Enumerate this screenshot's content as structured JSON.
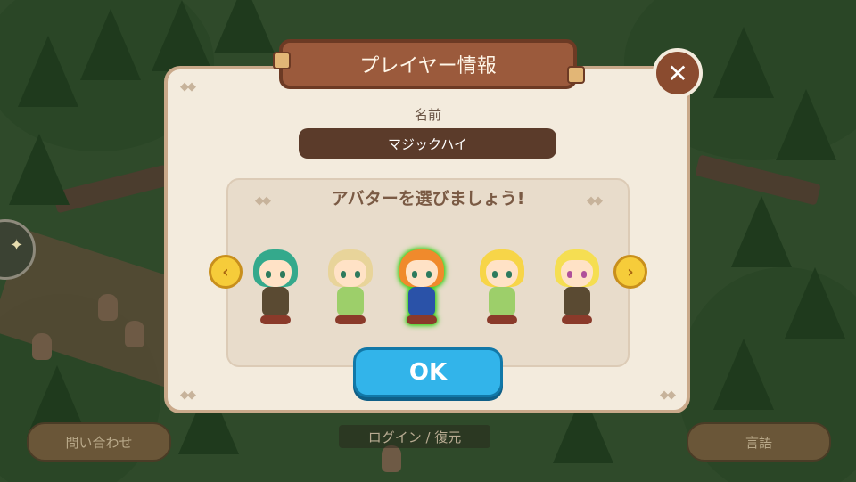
{
  "dialog": {
    "title": "プレイヤー情報",
    "name_label": "名前",
    "name_value": "マジックハイ",
    "avatar_heading": "アバターを選びましょう!",
    "ok_label": "OK",
    "close_icon": "close-icon",
    "prev_icon": "chevron-left-icon",
    "next_icon": "chevron-right-icon",
    "selected_avatar_index": 2
  },
  "avatars": [
    {
      "id": "avatar-1",
      "hair": "#34a98c",
      "outfit": "#5a4a32",
      "eye": "#2e7a5d"
    },
    {
      "id": "avatar-2",
      "hair": "#e8d49a",
      "outfit": "#9dcf6a",
      "eye": "#2e7a5d"
    },
    {
      "id": "avatar-3",
      "hair": "#f08a2c",
      "outfit": "#2a52a8",
      "eye": "#2e7a5d"
    },
    {
      "id": "avatar-4",
      "hair": "#f7d548",
      "outfit": "#9dcf6a",
      "eye": "#2e7a5d"
    },
    {
      "id": "avatar-5",
      "hair": "#f5de52",
      "outfit": "#5a4a32",
      "eye": "#b0509a"
    }
  ],
  "background": {
    "contact_button": "問い合わせ",
    "login_link": "ログイン / 復元",
    "language_button": "言語"
  },
  "colors": {
    "dialog_bg": "#f3ebdd",
    "banner": "#9b5a3c",
    "ok_button": "#32b4ea",
    "arrow_button": "#f6cc3a",
    "selected_glow": "#3bd21b"
  }
}
